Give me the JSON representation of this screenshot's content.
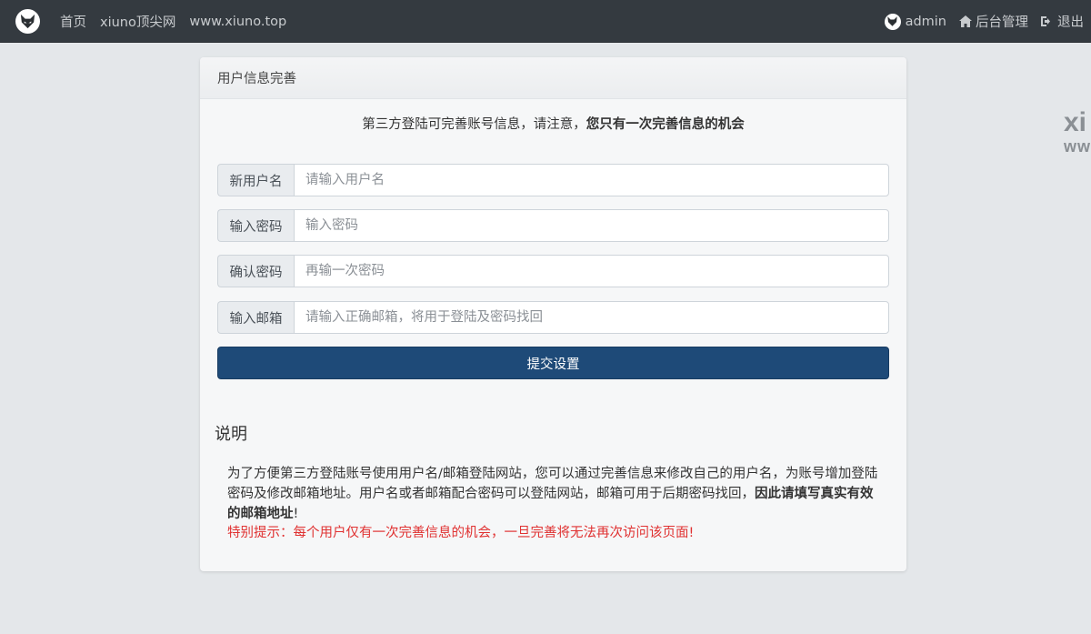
{
  "navbar": {
    "links": [
      "首页",
      "xiuno顶尖网",
      "www.xiuno.top"
    ],
    "user": "admin",
    "admin_label": "后台管理",
    "logout_label": "退出",
    "bg_color": "#343a40"
  },
  "side_watermark": {
    "line1": "xi",
    "line2": "ww"
  },
  "card": {
    "header": "用户信息完善",
    "notice_prefix": "第三方登陆可完善账号信息，请注意，",
    "notice_bold": "您只有一次完善信息的机会",
    "fields": [
      {
        "label": "新用户名",
        "placeholder": "请输入用户名"
      },
      {
        "label": "输入密码",
        "placeholder": "输入密码"
      },
      {
        "label": "确认密码",
        "placeholder": "再输一次密码"
      },
      {
        "label": "输入邮箱",
        "placeholder": "请输入正确邮箱，将用于登陆及密码找回"
      }
    ],
    "submit_label": "提交设置",
    "submit_color": "#1e4a78"
  },
  "explain": {
    "title": "说明",
    "desc_text": "为了方便第三方登陆账号使用用户名/邮箱登陆网站，您可以通过完善信息来修改自己的用户名，为账号增加登陆密码及修改邮箱地址。用户名或者邮箱配合密码可以登陆网站，邮箱可用于后期密码找回，",
    "desc_bold": "因此请填写真实有效的邮箱地址",
    "desc_end": "!",
    "warning": "特别提示：每个用户仅有一次完善信息的机会，一旦完善将无法再次访问该页面!",
    "warning_color": "#e03232"
  }
}
